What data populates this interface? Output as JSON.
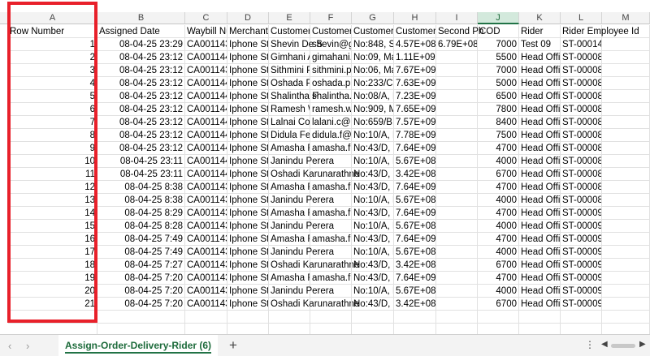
{
  "columns": [
    {
      "letter": "A",
      "header": "Row Number"
    },
    {
      "letter": "B",
      "header": "Assigned Date"
    },
    {
      "letter": "C",
      "header": "Waybill Nu"
    },
    {
      "letter": "D",
      "header": "Merchant"
    },
    {
      "letter": "E",
      "header": "Customer I"
    },
    {
      "letter": "F",
      "header": "Customer I"
    },
    {
      "letter": "G",
      "header": "Customer A"
    },
    {
      "letter": "H",
      "header": "Customer I"
    },
    {
      "letter": "I",
      "header": "Second Ph"
    },
    {
      "letter": "J",
      "header": "COD"
    },
    {
      "letter": "K",
      "header": "Rider"
    },
    {
      "letter": "L",
      "header": "Rider Employee Id"
    },
    {
      "letter": "M",
      "header": ""
    }
  ],
  "rows": [
    [
      "1",
      "08-04-25 23:29",
      "CA001143",
      "Iphone Sto",
      "Shevin De S",
      "shevin@gm",
      "No:848, Su",
      "4.57E+08",
      "6.79E+08",
      "7000",
      "Test 09",
      "ST-00014"
    ],
    [
      "2",
      "08-04-25 23:12",
      "CA001144",
      "Iphone Sto",
      "Gimhani A",
      "gimahani.a",
      "No:09, Ma",
      "1.11E+09",
      "",
      "5500",
      "Head Offic",
      "ST-00008"
    ],
    [
      "3",
      "08-04-25 23:12",
      "CA001143",
      "Iphone Sto",
      "Sithmini P",
      "sithmini.p",
      "No:06, Ma",
      "7.67E+09",
      "",
      "7000",
      "Head Offic",
      "ST-00008"
    ],
    [
      "4",
      "08-04-25 23:12",
      "CA001144",
      "Iphone Sto",
      "Oshada Pi",
      "oshada.p@",
      "No:233/C,",
      "7.63E+09",
      "",
      "5000",
      "Head Offic",
      "ST-00008"
    ],
    [
      "5",
      "08-04-25 23:12",
      "CA001144",
      "Iphone Sto",
      "Shalintha F",
      "shalintha.f",
      "No:08/A, N",
      "7.23E+09",
      "",
      "6500",
      "Head Offic",
      "ST-00008"
    ],
    [
      "6",
      "08-04-25 23:12",
      "CA001144",
      "Iphone Sto",
      "Ramesh W",
      "ramesh.w",
      "No:909, M",
      "7.65E+09",
      "",
      "7800",
      "Head Offic",
      "ST-00008"
    ],
    [
      "7",
      "08-04-25 23:12",
      "CA001144",
      "Iphone Sto",
      "Lalnai Coo",
      "lalani.c@g",
      "No:659/B,",
      "7.57E+09",
      "",
      "8400",
      "Head Offic",
      "ST-00008"
    ],
    [
      "8",
      "08-04-25 23:12",
      "CA001144",
      "Iphone Sto",
      "Didula Fer",
      "didula.f@",
      "No:10/A, N",
      "7.78E+09",
      "",
      "7500",
      "Head Offic",
      "ST-00008"
    ],
    [
      "9",
      "08-04-25 23:12",
      "CA001144",
      "Iphone Sto",
      "Amasha F",
      "amasha.f@",
      "No:43/D, N",
      "7.64E+09",
      "",
      "4700",
      "Head Offic",
      "ST-00008"
    ],
    [
      "10",
      "08-04-25 23:11",
      "CA001144",
      "Iphone Sto",
      "Janindu Perera",
      "",
      "No:10/A, N",
      "5.67E+08",
      "",
      "4000",
      "Head Offic",
      "ST-00008"
    ],
    [
      "11",
      "08-04-25 23:11",
      "CA001144",
      "Iphone Sto",
      "Oshadi Karunarathne",
      "",
      "No:43/D, N",
      "3.42E+08",
      "",
      "6700",
      "Head Offic",
      "ST-00008"
    ],
    [
      "12",
      "08-04-25 8:38",
      "CA001143",
      "Iphone Sto",
      "Amasha F",
      "amasha.f@",
      "No:43/D, N",
      "7.64E+09",
      "",
      "4700",
      "Head Offic",
      "ST-00008"
    ],
    [
      "13",
      "08-04-25 8:38",
      "CA001143",
      "Iphone Sto",
      "Janindu Perera",
      "",
      "No:10/A, N",
      "5.67E+08",
      "",
      "4000",
      "Head Offic",
      "ST-00008"
    ],
    [
      "14",
      "08-04-25 8:29",
      "CA001143",
      "Iphone Sto",
      "Amasha F",
      "amasha.f@",
      "No:43/D, N",
      "7.64E+09",
      "",
      "4700",
      "Head Offic",
      "ST-00009"
    ],
    [
      "15",
      "08-04-25 8:28",
      "CA001143",
      "Iphone Sto",
      "Janindu Perera",
      "",
      "No:10/A, N",
      "5.67E+08",
      "",
      "4000",
      "Head Offic",
      "ST-00009"
    ],
    [
      "16",
      "08-04-25 7:49",
      "CA001143",
      "Iphone Sto",
      "Amasha F",
      "amasha.f@",
      "No:43/D, N",
      "7.64E+09",
      "",
      "4700",
      "Head Offic",
      "ST-00009"
    ],
    [
      "17",
      "08-04-25 7:49",
      "CA001143",
      "Iphone Sto",
      "Janindu Perera",
      "",
      "No:10/A, N",
      "5.67E+08",
      "",
      "4000",
      "Head Offic",
      "ST-00009"
    ],
    [
      "18",
      "08-04-25 7:27",
      "CA001143",
      "Iphone Sto",
      "Oshadi Karunarathne",
      "",
      "No:43/D, N",
      "3.42E+08",
      "",
      "6700",
      "Head Offic",
      "ST-00009"
    ],
    [
      "19",
      "08-04-25 7:20",
      "CA001143",
      "Iphone Sto",
      "Amasha F",
      "amasha.f@",
      "No:43/D, N",
      "7.64E+09",
      "",
      "4700",
      "Head Offic",
      "ST-00009"
    ],
    [
      "20",
      "08-04-25 7:20",
      "CA001143",
      "Iphone Sto",
      "Janindu Perera",
      "",
      "No:10/A, N",
      "5.67E+08",
      "",
      "4000",
      "Head Offic",
      "ST-00009"
    ],
    [
      "21",
      "08-04-25 7:20",
      "CA001143",
      "Iphone Sto",
      "Oshadi Karunarathne",
      "",
      "No:43/D, N",
      "3.42E+08",
      "",
      "6700",
      "Head Offic",
      "ST-00009"
    ]
  ],
  "selected_column": "J",
  "tabbar": {
    "sheet_name": "Assign-Order-Delivery-Rider (6)",
    "add_label": "+",
    "more_label": "⋮",
    "scroll_left": "◀",
    "scroll_right": "▶"
  },
  "colors": {
    "accent": "#217346",
    "highlight": "#e8202a",
    "header_bg": "#f3f3f3"
  }
}
